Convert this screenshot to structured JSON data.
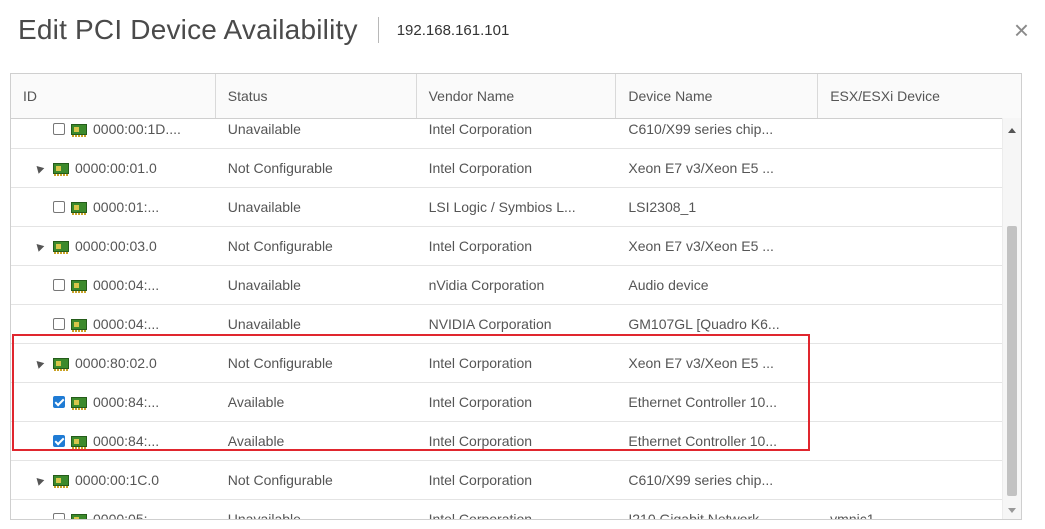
{
  "dialog": {
    "title": "Edit PCI Device Availability",
    "host": "192.168.161.101",
    "close_glyph": "×"
  },
  "columns": [
    "ID",
    "Status",
    "Vendor Name",
    "Device Name",
    "ESX/ESXi Device"
  ],
  "rows": [
    {
      "kind": "child",
      "checked": false,
      "id": "0000:00:1D....",
      "status": "Unavailable",
      "vendor": "Intel Corporation",
      "device": "C610/X99 series chip...",
      "esx": ""
    },
    {
      "kind": "parent",
      "checked": false,
      "id": "0000:00:01.0",
      "status": "Not Configurable",
      "vendor": "Intel Corporation",
      "device": "Xeon E7 v3/Xeon E5 ...",
      "esx": ""
    },
    {
      "kind": "child",
      "checked": false,
      "id": "0000:01:...",
      "status": "Unavailable",
      "vendor": "LSI Logic / Symbios L...",
      "device": "LSI2308_1",
      "esx": ""
    },
    {
      "kind": "parent",
      "checked": false,
      "id": "0000:00:03.0",
      "status": "Not Configurable",
      "vendor": "Intel Corporation",
      "device": "Xeon E7 v3/Xeon E5 ...",
      "esx": ""
    },
    {
      "kind": "child",
      "checked": false,
      "id": "0000:04:...",
      "status": "Unavailable",
      "vendor": "nVidia Corporation",
      "device": "Audio device",
      "esx": ""
    },
    {
      "kind": "child",
      "checked": false,
      "id": "0000:04:...",
      "status": "Unavailable",
      "vendor": "NVIDIA Corporation",
      "device": "GM107GL [Quadro K6...",
      "esx": ""
    },
    {
      "kind": "parent",
      "checked": false,
      "id": "0000:80:02.0",
      "status": "Not Configurable",
      "vendor": "Intel Corporation",
      "device": "Xeon E7 v3/Xeon E5 ...",
      "esx": ""
    },
    {
      "kind": "child",
      "checked": true,
      "id": "0000:84:...",
      "status": "Available",
      "vendor": "Intel Corporation",
      "device": "Ethernet Controller 10...",
      "esx": ""
    },
    {
      "kind": "child",
      "checked": true,
      "id": "0000:84:...",
      "status": "Available",
      "vendor": "Intel Corporation",
      "device": "Ethernet Controller 10...",
      "esx": ""
    },
    {
      "kind": "parent",
      "checked": false,
      "id": "0000:00:1C.0",
      "status": "Not Configurable",
      "vendor": "Intel Corporation",
      "device": "C610/X99 series chip...",
      "esx": ""
    },
    {
      "kind": "child",
      "checked": false,
      "id": "0000:05:...",
      "status": "Unavailable",
      "vendor": "Intel Corporation",
      "device": "I210 Gigabit Network ...",
      "esx": "vmnic1"
    }
  ],
  "colors": {
    "highlight": "#e0262e",
    "checkbox_checked": "#1f7bd4",
    "device_icon": "#3c8a2c"
  },
  "icons": {
    "expand": "caret-icon",
    "device": "pci-device-icon",
    "close": "close-icon"
  }
}
